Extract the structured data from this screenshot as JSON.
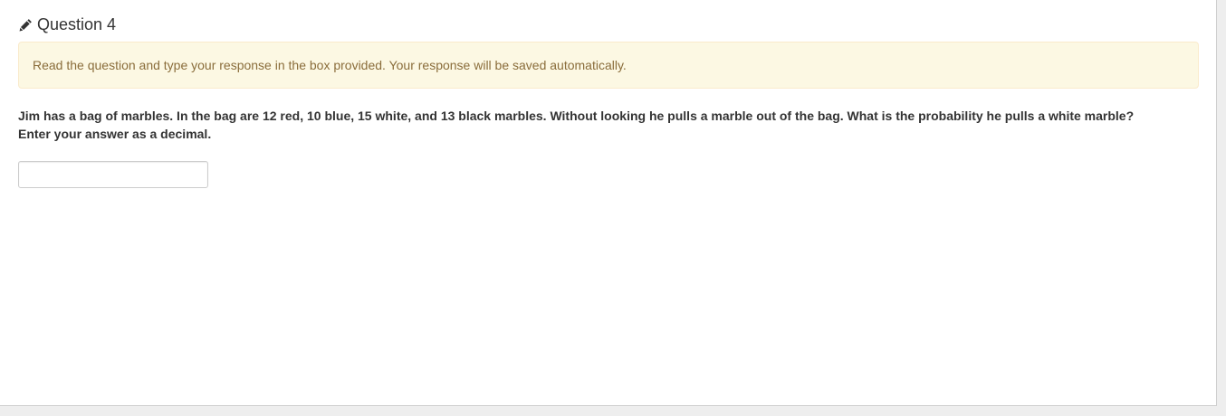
{
  "question": {
    "title": "Question 4",
    "icon": "pencil-icon"
  },
  "instructions": {
    "text": "Read the question and type your response in the box provided. Your response will be saved automatically."
  },
  "prompt": {
    "line1": "Jim has a bag of marbles. In the bag are 12 red, 10 blue, 15 white, and 13 black marbles. Without looking he pulls a marble out of the bag. What is the probability he pulls a white marble?",
    "line2": "Enter your answer as a decimal."
  },
  "answer": {
    "value": "",
    "placeholder": ""
  },
  "colors": {
    "alert_bg": "#fcf8e3",
    "alert_text": "#8a6d3b",
    "alert_border": "#faebcc",
    "text": "#333333"
  }
}
